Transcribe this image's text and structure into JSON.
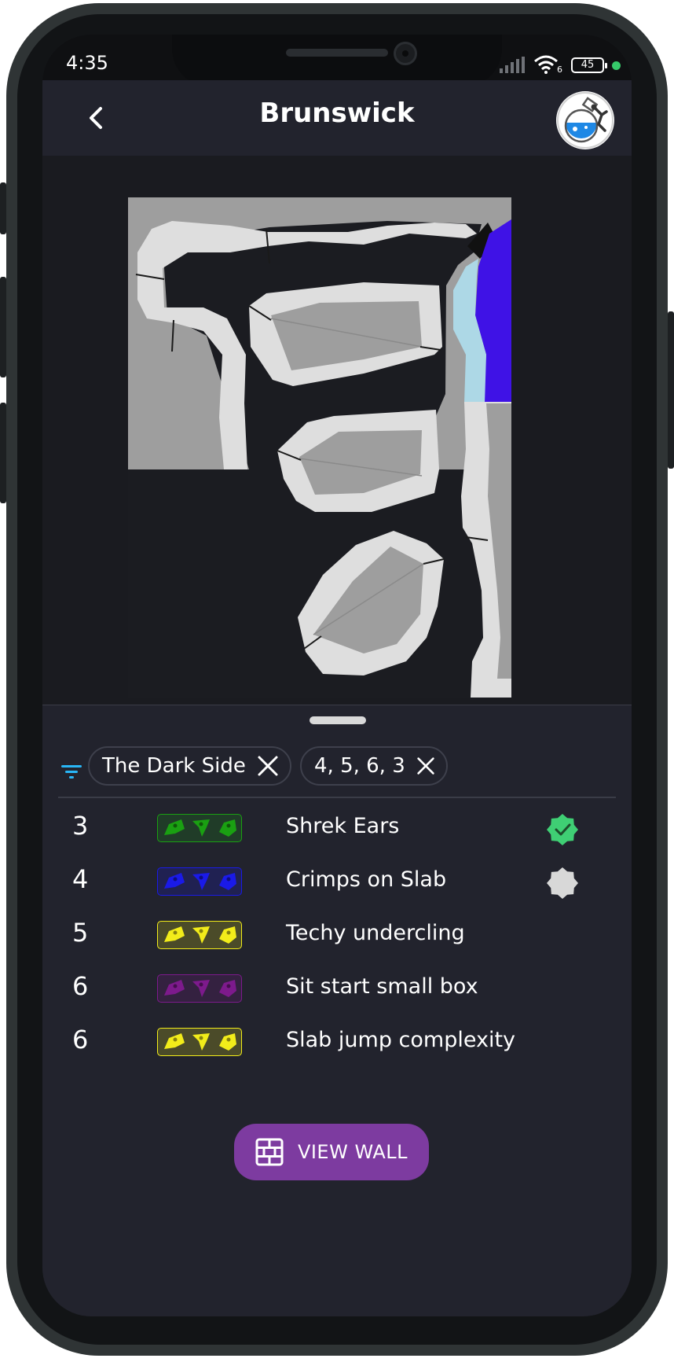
{
  "status_bar": {
    "time": "4:35",
    "network": "6",
    "battery": "45"
  },
  "app_bar": {
    "title": "Brunswick"
  },
  "filters": {
    "chips": [
      {
        "label": "The Dark Side"
      },
      {
        "label": "4, 5, 6, 3"
      }
    ]
  },
  "routes": [
    {
      "grade": "3",
      "name": "Shrek Ears",
      "hold_color": "#1aa012",
      "badge": "completed"
    },
    {
      "grade": "4",
      "name": "Crimps on Slab",
      "hold_color": "#1a1ae8",
      "badge": "not-completed"
    },
    {
      "grade": "5",
      "name": "Techy undercling",
      "hold_color": "#f2ec1a",
      "badge": "none"
    },
    {
      "grade": "6",
      "name": "Sit start small box",
      "hold_color": "#7d1a8c",
      "badge": "none"
    },
    {
      "grade": "6",
      "name": "Slab jump complexity",
      "hold_color": "#f2ec1a",
      "badge": "none"
    }
  ],
  "actions": {
    "view_wall": "VIEW WALL"
  },
  "colors": {
    "accent": "#7d3ba0",
    "sheet": "#22232d",
    "completed": "#3fcf74"
  }
}
